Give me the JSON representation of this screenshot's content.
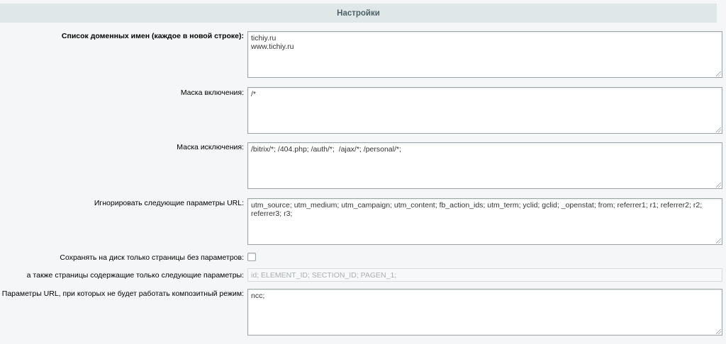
{
  "section": {
    "title": "Настройки"
  },
  "fields": {
    "domains": {
      "label": "Список доменных имен (каждое в новой строке):",
      "value": "tichiy.ru\nwww.tichiy.ru"
    },
    "include_mask": {
      "label": "Маска включения:",
      "value": "/*"
    },
    "exclude_mask": {
      "label": "Маска исключения:",
      "value": "/bitrix/*; /404.php; /auth/*;  /ajax/*; /personal/*;"
    },
    "ignore_params": {
      "label": "Игнорировать следующие параметры URL:",
      "value": "utm_source; utm_medium; utm_campaign; utm_content; fb_action_ids; utm_term; yclid; gclid; _openstat; from; referrer1; r1; referrer2; r2; referrer3; r3;"
    },
    "save_no_params": {
      "label": "Сохранять на диск только страницы без параметров:",
      "checked": false
    },
    "only_params": {
      "label": "а также страницы содержащие только следующие параметры:",
      "value": "id; ELEMENT_ID; SECTION_ID; PAGEN_1;"
    },
    "no_composite_params": {
      "label": "Параметры URL, при которых не будет работать композитный режим:",
      "value": "ncc;"
    }
  }
}
